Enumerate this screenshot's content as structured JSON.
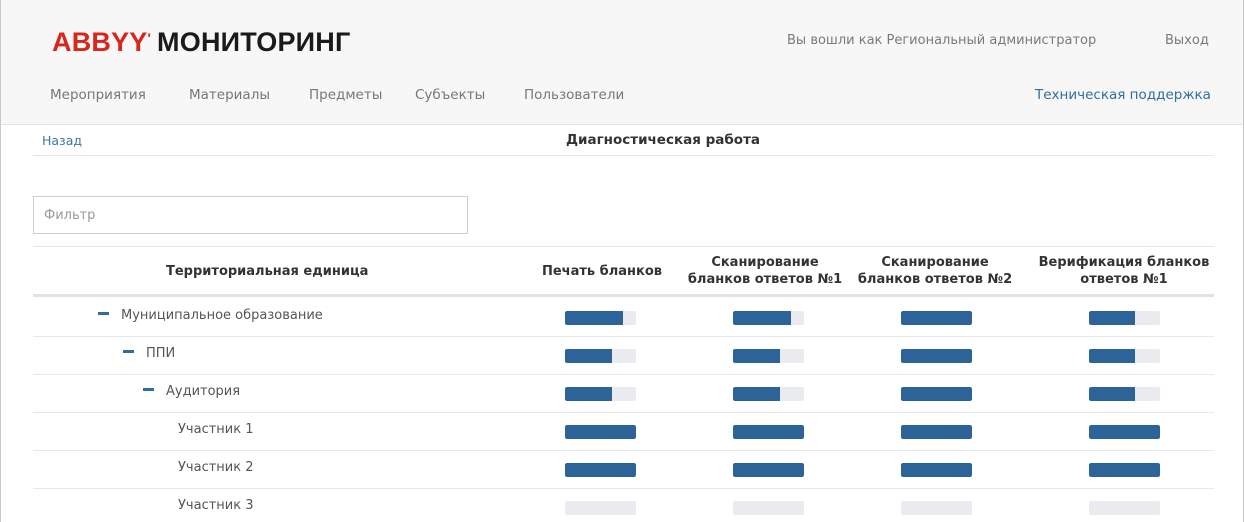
{
  "header": {
    "logo_brand": "ABBYY",
    "logo_mark": "'",
    "logo_product": "МОНИТОРИНГ",
    "user_info": "Вы вошли как Региональный администратор",
    "logout": "Выход"
  },
  "nav": {
    "items": [
      "Мероприятия",
      "Материалы",
      "Предметы",
      "Субъекты",
      "Пользователи"
    ],
    "support": "Техническая поддержка"
  },
  "page": {
    "back": "Назад",
    "title": "Диагностическая работа"
  },
  "filter": {
    "placeholder": "Фильтр",
    "value": ""
  },
  "table": {
    "columns": [
      "Территориальная единица",
      "Печать бланков",
      "Сканирование бланков ответов №1",
      "Сканирование бланков ответов №2",
      "Верификация бланков ответов №1"
    ],
    "column_lines": [
      [
        "Территориальная единица"
      ],
      [
        "Печать бланков"
      ],
      [
        "Сканирование",
        "бланков ответов №1"
      ],
      [
        "Сканирование",
        "бланков ответов №2"
      ],
      [
        "Верификация бланков",
        "ответов №1"
      ]
    ],
    "rows": [
      {
        "label": "Муниципальное образование",
        "collapsible": true,
        "level": 0,
        "progress": [
          0.82,
          0.82,
          1.0,
          0.65
        ]
      },
      {
        "label": "ППИ",
        "collapsible": true,
        "level": 1,
        "progress": [
          0.66,
          0.66,
          1.0,
          0.65
        ]
      },
      {
        "label": "Аудитория",
        "collapsible": true,
        "level": 2,
        "progress": [
          0.66,
          0.66,
          1.0,
          0.65
        ]
      },
      {
        "label": "Участник 1",
        "collapsible": false,
        "level": 3,
        "progress": [
          1.0,
          1.0,
          1.0,
          1.0
        ]
      },
      {
        "label": "Участник 2",
        "collapsible": false,
        "level": 3,
        "progress": [
          1.0,
          1.0,
          1.0,
          1.0
        ]
      },
      {
        "label": "Участник 3",
        "collapsible": false,
        "level": 3,
        "progress": [
          0,
          0,
          0,
          0
        ]
      }
    ]
  },
  "colors": {
    "brand_red": "#d9261c",
    "bar_fill": "#2c6499",
    "bar_track": "#e9ebee",
    "link": "#2f6e9e"
  }
}
